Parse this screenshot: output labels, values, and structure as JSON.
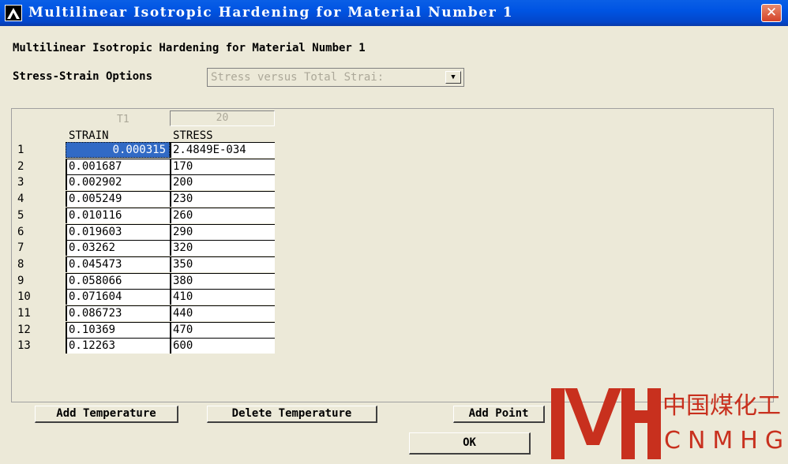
{
  "window": {
    "title": "Multilinear Isotropic Hardening for Material Number 1",
    "close_glyph": "✕"
  },
  "heading": "Multilinear Isotropic Hardening for Material Number 1",
  "options": {
    "label": "Stress-Strain Options",
    "value": "Stress versus Total Strai:"
  },
  "table": {
    "temp_label": "T1",
    "temp_value": "20",
    "columns": [
      "STRAIN",
      "STRESS"
    ],
    "rows": [
      {
        "num": "1",
        "strain": "0.000315",
        "stress": "2.4849E-034"
      },
      {
        "num": "2",
        "strain": "0.001687",
        "stress": "170"
      },
      {
        "num": "3",
        "strain": "0.002902",
        "stress": "200"
      },
      {
        "num": "4",
        "strain": "0.005249",
        "stress": "230"
      },
      {
        "num": "5",
        "strain": "0.010116",
        "stress": "260"
      },
      {
        "num": "6",
        "strain": "0.019603",
        "stress": "290"
      },
      {
        "num": "7",
        "strain": "0.03262",
        "stress": "320"
      },
      {
        "num": "8",
        "strain": "0.045473",
        "stress": "350"
      },
      {
        "num": "9",
        "strain": "0.058066",
        "stress": "380"
      },
      {
        "num": "10",
        "strain": "0.071604",
        "stress": "410"
      },
      {
        "num": "11",
        "strain": "0.086723",
        "stress": "440"
      },
      {
        "num": "12",
        "strain": "0.10369",
        "stress": "470"
      },
      {
        "num": "13",
        "strain": "0.12263",
        "stress": "600"
      }
    ]
  },
  "buttons": {
    "add_temperature": "Add Temperature",
    "delete_temperature": "Delete Temperature",
    "add_point": "Add Point",
    "ok": "OK"
  },
  "watermark": {
    "chinese": "中国煤化工",
    "latin": "CNMHG",
    "color": "#c8301e"
  }
}
